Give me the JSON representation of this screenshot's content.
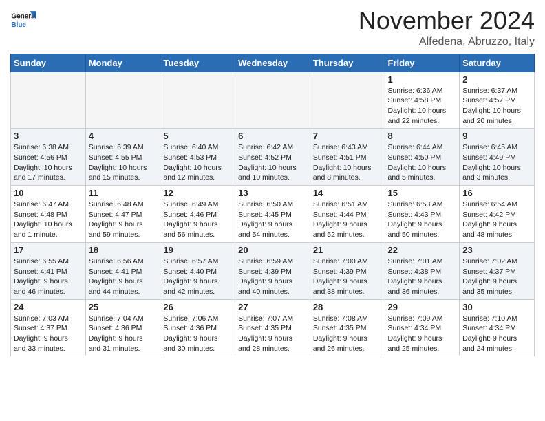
{
  "header": {
    "logo_general": "General",
    "logo_blue": "Blue",
    "month_title": "November 2024",
    "location": "Alfedena, Abruzzo, Italy"
  },
  "weekdays": [
    "Sunday",
    "Monday",
    "Tuesday",
    "Wednesday",
    "Thursday",
    "Friday",
    "Saturday"
  ],
  "weeks": [
    {
      "class": "week-odd",
      "days": [
        {
          "num": "",
          "info": "",
          "empty": true
        },
        {
          "num": "",
          "info": "",
          "empty": true
        },
        {
          "num": "",
          "info": "",
          "empty": true
        },
        {
          "num": "",
          "info": "",
          "empty": true
        },
        {
          "num": "",
          "info": "",
          "empty": true
        },
        {
          "num": "1",
          "info": "Sunrise: 6:36 AM\nSunset: 4:58 PM\nDaylight: 10 hours\nand 22 minutes.",
          "empty": false
        },
        {
          "num": "2",
          "info": "Sunrise: 6:37 AM\nSunset: 4:57 PM\nDaylight: 10 hours\nand 20 minutes.",
          "empty": false
        }
      ]
    },
    {
      "class": "week-even",
      "days": [
        {
          "num": "3",
          "info": "Sunrise: 6:38 AM\nSunset: 4:56 PM\nDaylight: 10 hours\nand 17 minutes.",
          "empty": false
        },
        {
          "num": "4",
          "info": "Sunrise: 6:39 AM\nSunset: 4:55 PM\nDaylight: 10 hours\nand 15 minutes.",
          "empty": false
        },
        {
          "num": "5",
          "info": "Sunrise: 6:40 AM\nSunset: 4:53 PM\nDaylight: 10 hours\nand 12 minutes.",
          "empty": false
        },
        {
          "num": "6",
          "info": "Sunrise: 6:42 AM\nSunset: 4:52 PM\nDaylight: 10 hours\nand 10 minutes.",
          "empty": false
        },
        {
          "num": "7",
          "info": "Sunrise: 6:43 AM\nSunset: 4:51 PM\nDaylight: 10 hours\nand 8 minutes.",
          "empty": false
        },
        {
          "num": "8",
          "info": "Sunrise: 6:44 AM\nSunset: 4:50 PM\nDaylight: 10 hours\nand 5 minutes.",
          "empty": false
        },
        {
          "num": "9",
          "info": "Sunrise: 6:45 AM\nSunset: 4:49 PM\nDaylight: 10 hours\nand 3 minutes.",
          "empty": false
        }
      ]
    },
    {
      "class": "week-odd",
      "days": [
        {
          "num": "10",
          "info": "Sunrise: 6:47 AM\nSunset: 4:48 PM\nDaylight: 10 hours\nand 1 minute.",
          "empty": false
        },
        {
          "num": "11",
          "info": "Sunrise: 6:48 AM\nSunset: 4:47 PM\nDaylight: 9 hours\nand 59 minutes.",
          "empty": false
        },
        {
          "num": "12",
          "info": "Sunrise: 6:49 AM\nSunset: 4:46 PM\nDaylight: 9 hours\nand 56 minutes.",
          "empty": false
        },
        {
          "num": "13",
          "info": "Sunrise: 6:50 AM\nSunset: 4:45 PM\nDaylight: 9 hours\nand 54 minutes.",
          "empty": false
        },
        {
          "num": "14",
          "info": "Sunrise: 6:51 AM\nSunset: 4:44 PM\nDaylight: 9 hours\nand 52 minutes.",
          "empty": false
        },
        {
          "num": "15",
          "info": "Sunrise: 6:53 AM\nSunset: 4:43 PM\nDaylight: 9 hours\nand 50 minutes.",
          "empty": false
        },
        {
          "num": "16",
          "info": "Sunrise: 6:54 AM\nSunset: 4:42 PM\nDaylight: 9 hours\nand 48 minutes.",
          "empty": false
        }
      ]
    },
    {
      "class": "week-even",
      "days": [
        {
          "num": "17",
          "info": "Sunrise: 6:55 AM\nSunset: 4:41 PM\nDaylight: 9 hours\nand 46 minutes.",
          "empty": false
        },
        {
          "num": "18",
          "info": "Sunrise: 6:56 AM\nSunset: 4:41 PM\nDaylight: 9 hours\nand 44 minutes.",
          "empty": false
        },
        {
          "num": "19",
          "info": "Sunrise: 6:57 AM\nSunset: 4:40 PM\nDaylight: 9 hours\nand 42 minutes.",
          "empty": false
        },
        {
          "num": "20",
          "info": "Sunrise: 6:59 AM\nSunset: 4:39 PM\nDaylight: 9 hours\nand 40 minutes.",
          "empty": false
        },
        {
          "num": "21",
          "info": "Sunrise: 7:00 AM\nSunset: 4:39 PM\nDaylight: 9 hours\nand 38 minutes.",
          "empty": false
        },
        {
          "num": "22",
          "info": "Sunrise: 7:01 AM\nSunset: 4:38 PM\nDaylight: 9 hours\nand 36 minutes.",
          "empty": false
        },
        {
          "num": "23",
          "info": "Sunrise: 7:02 AM\nSunset: 4:37 PM\nDaylight: 9 hours\nand 35 minutes.",
          "empty": false
        }
      ]
    },
    {
      "class": "week-odd",
      "days": [
        {
          "num": "24",
          "info": "Sunrise: 7:03 AM\nSunset: 4:37 PM\nDaylight: 9 hours\nand 33 minutes.",
          "empty": false
        },
        {
          "num": "25",
          "info": "Sunrise: 7:04 AM\nSunset: 4:36 PM\nDaylight: 9 hours\nand 31 minutes.",
          "empty": false
        },
        {
          "num": "26",
          "info": "Sunrise: 7:06 AM\nSunset: 4:36 PM\nDaylight: 9 hours\nand 30 minutes.",
          "empty": false
        },
        {
          "num": "27",
          "info": "Sunrise: 7:07 AM\nSunset: 4:35 PM\nDaylight: 9 hours\nand 28 minutes.",
          "empty": false
        },
        {
          "num": "28",
          "info": "Sunrise: 7:08 AM\nSunset: 4:35 PM\nDaylight: 9 hours\nand 26 minutes.",
          "empty": false
        },
        {
          "num": "29",
          "info": "Sunrise: 7:09 AM\nSunset: 4:34 PM\nDaylight: 9 hours\nand 25 minutes.",
          "empty": false
        },
        {
          "num": "30",
          "info": "Sunrise: 7:10 AM\nSunset: 4:34 PM\nDaylight: 9 hours\nand 24 minutes.",
          "empty": false
        }
      ]
    }
  ]
}
